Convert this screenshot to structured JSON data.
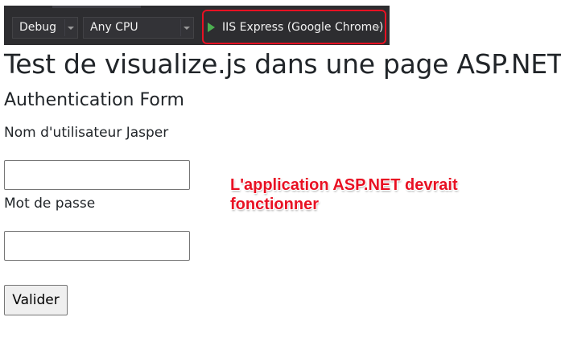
{
  "toolbar": {
    "configuration": "Debug",
    "platform": "Any CPU",
    "run_target": "IIS Express (Google Chrome)",
    "highlight_color": "#e81123",
    "play_color": "#4caf50"
  },
  "page": {
    "title": "Test de visualize.js dans une page ASP.NET",
    "form_title": "Authentication Form",
    "username_label": "Nom d'utilisateur Jasper",
    "username_value": "",
    "password_label": "Mot de passe",
    "password_value": "",
    "submit_label": "Valider"
  },
  "annotation": {
    "text": "L'application ASP.NET devrait fonctionner",
    "color": "#e81123"
  }
}
